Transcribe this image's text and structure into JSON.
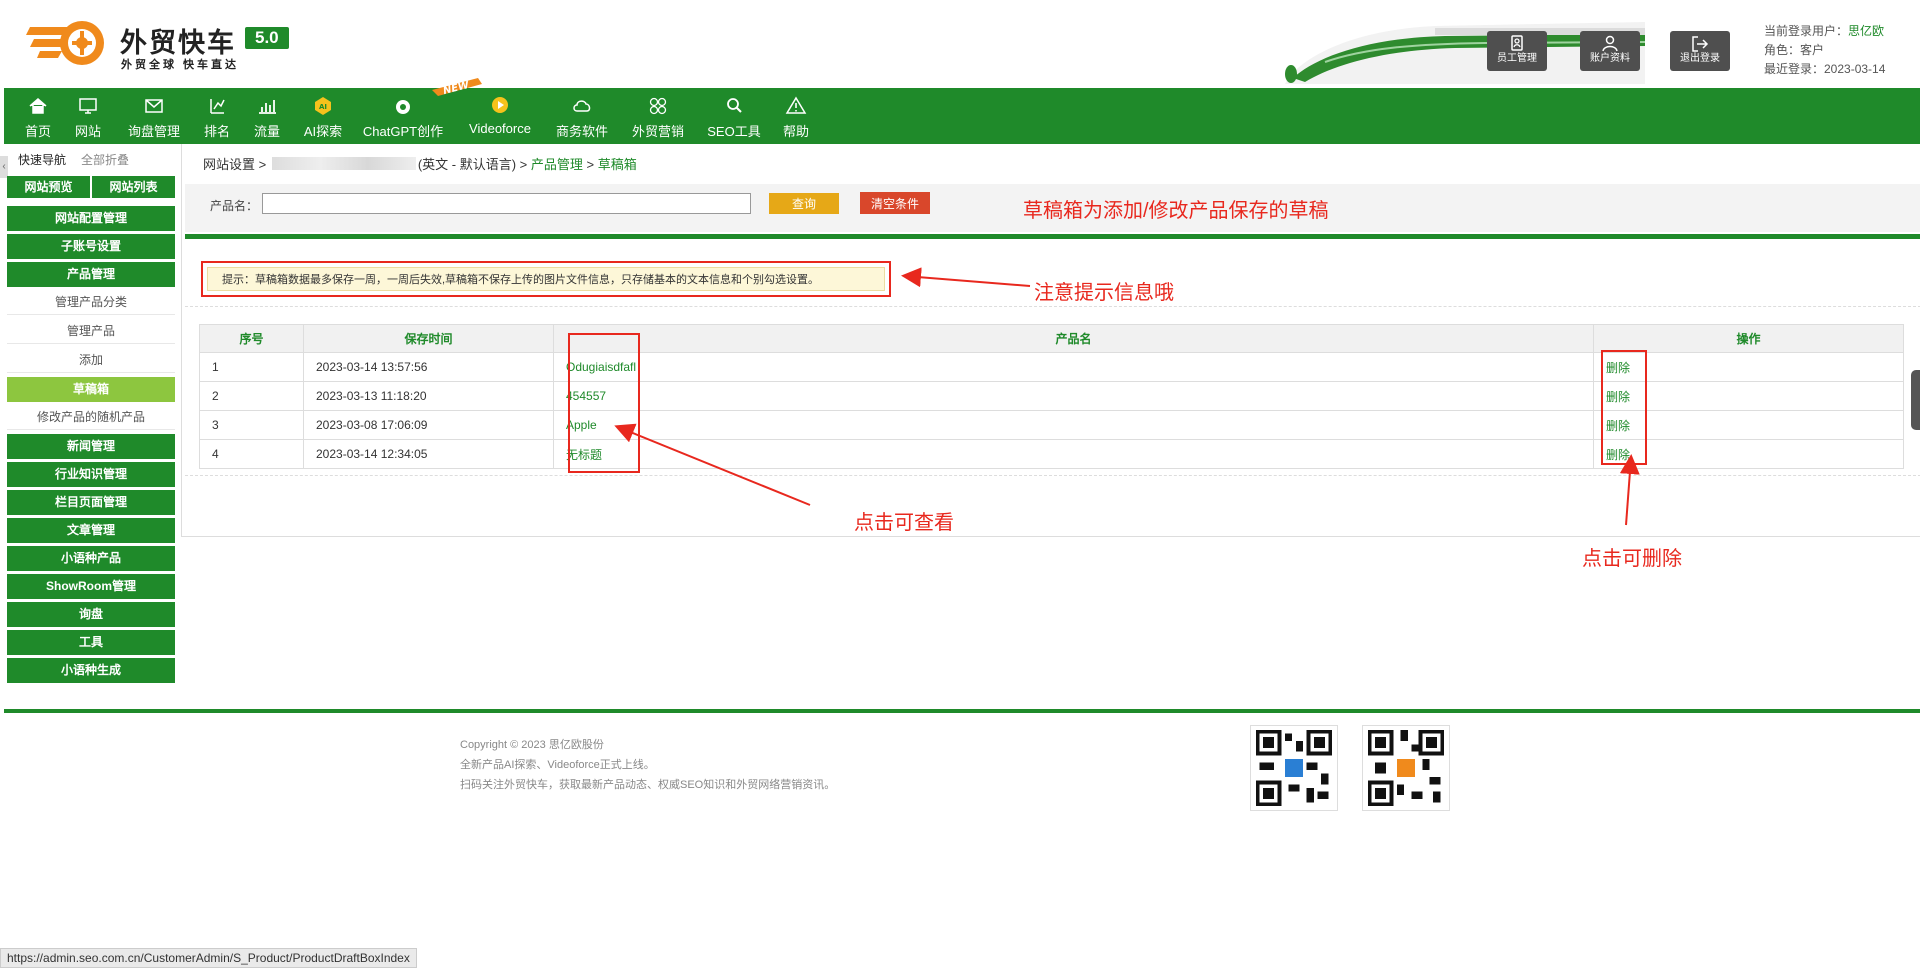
{
  "logo": {
    "title": "外贸快车",
    "version": "5.0",
    "slogan": "外贸全球 快车直达"
  },
  "header_buttons": {
    "staff": "员工管理",
    "account": "账户资料",
    "logout": "退出登录"
  },
  "user": {
    "current_label": "当前登录用户：",
    "current_value": "思亿欧",
    "role": "角色：客户",
    "last_login": "最近登录：2023-03-14"
  },
  "nav": [
    {
      "label": "首页",
      "icon": "home-icon"
    },
    {
      "label": "网站",
      "icon": "monitor-icon"
    },
    {
      "label": "询盘管理",
      "icon": "mail-icon"
    },
    {
      "label": "排名",
      "icon": "rank-icon"
    },
    {
      "label": "流量",
      "icon": "bar-chart-icon"
    },
    {
      "label": "AI探索",
      "icon": "ai-icon"
    },
    {
      "label": "ChatGPT创作",
      "icon": "chatgpt-icon"
    },
    {
      "label": "Videoforce",
      "icon": "video-icon"
    },
    {
      "label": "商务软件",
      "icon": "cloud-icon"
    },
    {
      "label": "外贸营销",
      "icon": "clover-icon"
    },
    {
      "label": "SEO工具",
      "icon": "search-icon"
    },
    {
      "label": "帮助",
      "icon": "warning-icon"
    }
  ],
  "new_badge": "NEW",
  "sidebar": {
    "tab_active": "快速导航",
    "tab_other": "全部折叠",
    "preview": "网站预览",
    "site_list": "网站列表",
    "items": [
      {
        "label": "网站配置管理",
        "kind": "green"
      },
      {
        "label": "子账号设置",
        "kind": "green"
      },
      {
        "label": "产品管理",
        "kind": "green"
      },
      {
        "label": "管理产品分类",
        "kind": "sub"
      },
      {
        "label": "管理产品",
        "kind": "sub"
      },
      {
        "label": "添加",
        "kind": "sub"
      },
      {
        "label": "草稿箱",
        "kind": "active"
      },
      {
        "label": "修改产品的随机产品",
        "kind": "sub"
      },
      {
        "label": "新闻管理",
        "kind": "green"
      },
      {
        "label": "行业知识管理",
        "kind": "green"
      },
      {
        "label": "栏目页面管理",
        "kind": "green"
      },
      {
        "label": "文章管理",
        "kind": "green"
      },
      {
        "label": "小语种产品",
        "kind": "green"
      },
      {
        "label": "ShowRoom管理",
        "kind": "green"
      },
      {
        "label": "询盘",
        "kind": "green"
      },
      {
        "label": "工具",
        "kind": "green"
      },
      {
        "label": "小语种生成",
        "kind": "green"
      }
    ]
  },
  "breadcrumb": {
    "root": "网站设置 > ",
    "lang": "(英文 - 默认语言) > ",
    "section": "产品管理",
    "sep": " > ",
    "current": "草稿箱"
  },
  "search": {
    "label": "产品名：",
    "value": "",
    "query_button": "查询",
    "clear_button": "清空条件"
  },
  "hint": "提示：草稿箱数据最多保存一周，一周后失效,草稿箱不保存上传的图片文件信息，只存储基本的文本信息和个别勾选设置。",
  "table": {
    "headers": [
      "序号",
      "保存时间",
      "产品名",
      "操作"
    ],
    "rows": [
      {
        "no": "1",
        "time": "2023-03-14 13:57:56",
        "name": "Odugiaisdfafl",
        "action": "删除"
      },
      {
        "no": "2",
        "time": "2023-03-13 11:18:20",
        "name": "454557",
        "action": "删除"
      },
      {
        "no": "3",
        "time": "2023-03-08 17:06:09",
        "name": "Apple",
        "action": "删除"
      },
      {
        "no": "4",
        "time": "2023-03-14 12:34:05",
        "name": "无标题",
        "action": "删除"
      }
    ]
  },
  "annotations": {
    "top": "草稿箱为添加/修改产品保存的草稿",
    "hint": "注意提示信息哦",
    "view": "点击可查看",
    "delete": "点击可删除"
  },
  "footer": {
    "copyright": "Copyright © 2023 思亿欧股份",
    "line2": "全新产品AI探索、Videoforce正式上线。",
    "line3": "扫码关注外贸快车，获取最新产品动态、权威SEO知识和外贸网络营销资讯。"
  },
  "status_url": "https://admin.seo.com.cn/CustomerAdmin/S_Product/ProductDraftBoxIndex",
  "colors": {
    "brand_green": "#1f8a2a",
    "active_green": "#8dc63f",
    "annotation_red": "#e8281e",
    "query_orange": "#e6a817",
    "clear_red": "#d9472b"
  }
}
